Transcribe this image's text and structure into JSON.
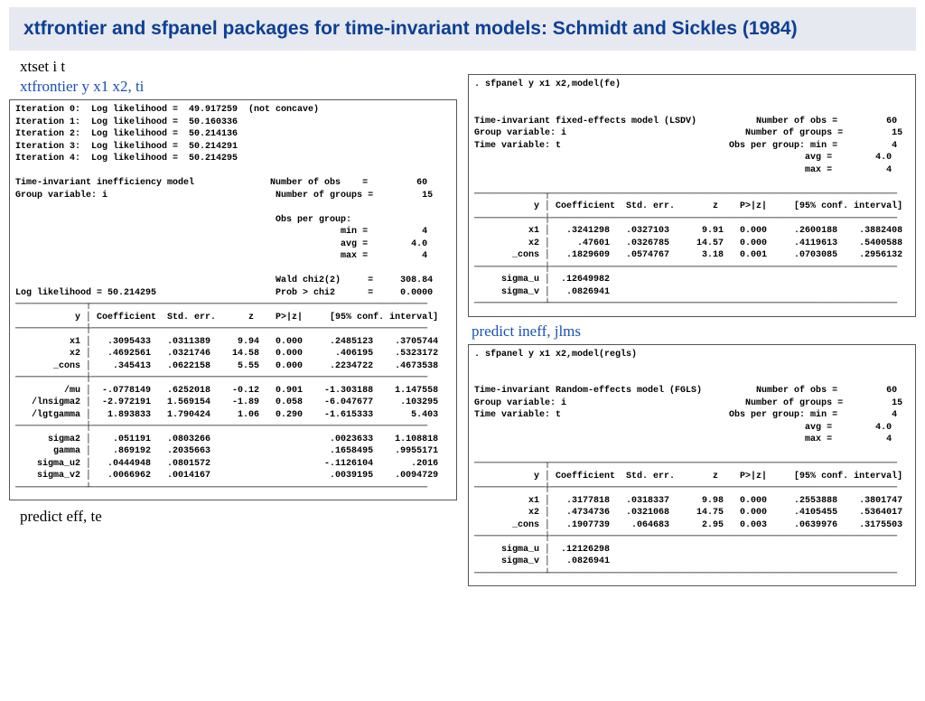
{
  "title": "xtfrontier and sfpanel packages for time-invariant models: Schmidt and Sickles (1984)",
  "left": {
    "cmd1": "xtset i t",
    "cmd2": "xtfrontier y x1 x2, ti",
    "out1": "Iteration 0:  Log likelihood =  49.917259  (not concave)\nIteration 1:  Log likelihood =  50.160336\nIteration 2:  Log likelihood =  50.214136\nIteration 3:  Log likelihood =  50.214291\nIteration 4:  Log likelihood =  50.214295\n\nTime-invariant inefficiency model              Number of obs    =         60\nGroup variable: i                               Number of groups =         15\n\n                                                Obs per group:\n                                                            min =          4\n                                                            avg =        4.0\n                                                            max =          4\n\n                                                Wald chi2(2)     =     308.84\nLog likelihood = 50.214295                      Prob > chi2      =     0.0000\n─────────────┬──────────────────────────────────────────────────────────────\n           y │ Coefficient  Std. err.      z    P>|z|     [95% conf. interval]\n─────────────┼──────────────────────────────────────────────────────────────\n          x1 │   .3095433   .0311389     9.94   0.000     .2485123    .3705744\n          x2 │   .4692561   .0321746    14.58   0.000      .406195    .5323172\n       _cons │    .345413   .0622158     5.55   0.000     .2234722    .4673538\n─────────────┼──────────────────────────────────────────────────────────────\n         /mu │  -.0778149   .6252018    -0.12   0.901    -1.303188    1.147558\n   /lnsigma2 │  -2.972191   1.569154    -1.89   0.058    -6.047677     .103295\n   /lgtgamma │   1.893833   1.790424     1.06   0.290    -1.615333       5.403\n─────────────┼──────────────────────────────────────────────────────────────\n      sigma2 │    .051191   .0803266                      .0023633    1.108818\n       gamma │    .869192   .2035663                      .1658495    .9955171\n    sigma_u2 │   .0444948   .0801572                     -.1126104       .2016\n    sigma_v2 │   .0066962   .0014167                      .0039195    .0094729\n─────────────┴──────────────────────────────────────────────────────────────",
    "cmd3": "predict eff, te"
  },
  "right": {
    "out1": ". sfpanel y x1 x2,model(fe)\n\n\nTime-invariant fixed-effects model (LSDV)           Number of obs =         60\nGroup variable: i                                 Number of groups =         15\nTime variable: t                               Obs per group: min =          4\n                                                             avg =        4.0\n                                                             max =          4\n\n─────────────┬────────────────────────────────────────────────────────────────\n           y │ Coefficient  Std. err.       z    P>|z|     [95% conf. interval]\n─────────────┼────────────────────────────────────────────────────────────────\n          x1 │   .3241298   .0327103      9.91   0.000     .2600188    .3882408\n          x2 │     .47601   .0326785     14.57   0.000     .4119613    .5400588\n       _cons │   .1829609   .0574767      3.18   0.001     .0703085    .2956132\n─────────────┼────────────────────────────────────────────────────────────────\n     sigma_u │  .12649982\n     sigma_v │   .0826941\n─────────────┴────────────────────────────────────────────────────────────────",
    "cmd_mid": "predict ineff, jlms",
    "out2": ". sfpanel y x1 x2,model(regls)\n\n\nTime-invariant Random-effects model (FGLS)          Number of obs =         60\nGroup variable: i                                 Number of groups =         15\nTime variable: t                               Obs per group: min =          4\n                                                             avg =        4.0\n                                                             max =          4\n\n─────────────┬────────────────────────────────────────────────────────────────\n           y │ Coefficient  Std. err.       z    P>|z|     [95% conf. interval]\n─────────────┼────────────────────────────────────────────────────────────────\n          x1 │   .3177818   .0318337      9.98   0.000     .2553888    .3801747\n          x2 │   .4734736   .0321068     14.75   0.000     .4105455    .5364017\n       _cons │   .1907739    .064683      2.95   0.003     .0639976    .3175503\n─────────────┼────────────────────────────────────────────────────────────────\n     sigma_u │  .12126298\n     sigma_v │   .0826941\n─────────────┴────────────────────────────────────────────────────────────────"
  }
}
